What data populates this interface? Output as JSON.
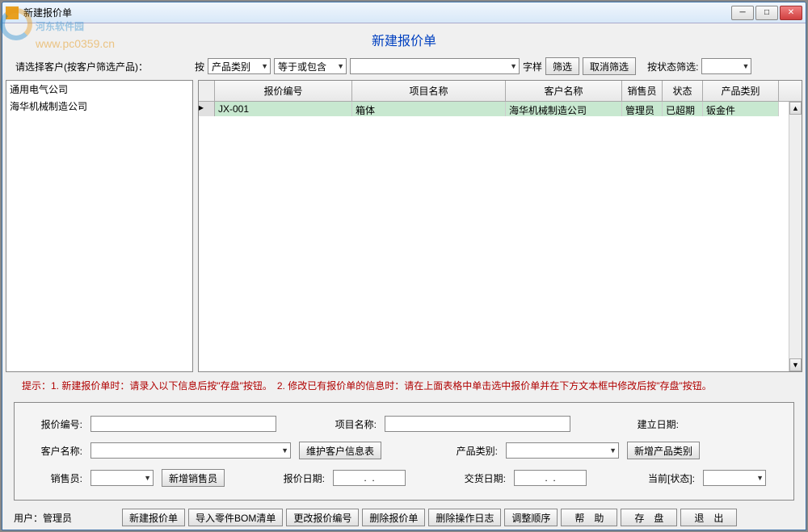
{
  "window": {
    "title": "新建报价单"
  },
  "watermark": {
    "text": "河东软件园",
    "url": "www.pc0359.cn"
  },
  "page_title": "新建报价单",
  "sidebar": {
    "label": "请选择客户(按客户筛选产品)：",
    "items": [
      "通用电气公司",
      "海华机械制造公司"
    ]
  },
  "filter": {
    "by_label": "按",
    "by_value": "产品类别",
    "cond_value": "等于或包含",
    "text_value": "",
    "suffix": "字样",
    "btn_filter": "筛选",
    "btn_cancel": "取消筛选",
    "state_label": "按状态筛选:",
    "state_value": ""
  },
  "table": {
    "headers": [
      "报价编号",
      "项目名称",
      "客户名称",
      "销售员",
      "状态",
      "产品类别"
    ],
    "rows": [
      {
        "quote_no": "JX-001",
        "project": "箱体",
        "customer": "海华机械制造公司",
        "sales": "管理员",
        "status": "已超期",
        "category": "钣金件"
      }
    ]
  },
  "hint": "提示：1. 新建报价单时：请录入以下信息后按\"存盘\"按钮。　2. 修改已有报价单的信息时：请在上面表格中单击选中报价单并在下方文本框中修改后按\"存盘\"按钮。",
  "form": {
    "quote_no": {
      "label": "报价编号:",
      "value": ""
    },
    "project": {
      "label": "项目名称:",
      "value": ""
    },
    "create_date": {
      "label": "建立日期:",
      "value": ""
    },
    "customer": {
      "label": "客户名称:",
      "value": "",
      "btn": "维护客户信息表"
    },
    "category": {
      "label": "产品类别:",
      "value": "",
      "btn": "新增产品类别"
    },
    "sales": {
      "label": "销售员:",
      "value": "",
      "btn": "新增销售员"
    },
    "quote_date": {
      "label": "报价日期:",
      "value": "  .  .  "
    },
    "delivery_date": {
      "label": "交货日期:",
      "value": "  .  .  "
    },
    "current_status": {
      "label": "当前[状态]:",
      "value": ""
    }
  },
  "footer": {
    "user_label": "用户：",
    "user_value": "管理员",
    "buttons": [
      "新建报价单",
      "导入零件BOM清单",
      "更改报价编号",
      "删除报价单",
      "删除操作日志",
      "调整顺序",
      "帮　助",
      "存　盘",
      "退　出"
    ]
  }
}
